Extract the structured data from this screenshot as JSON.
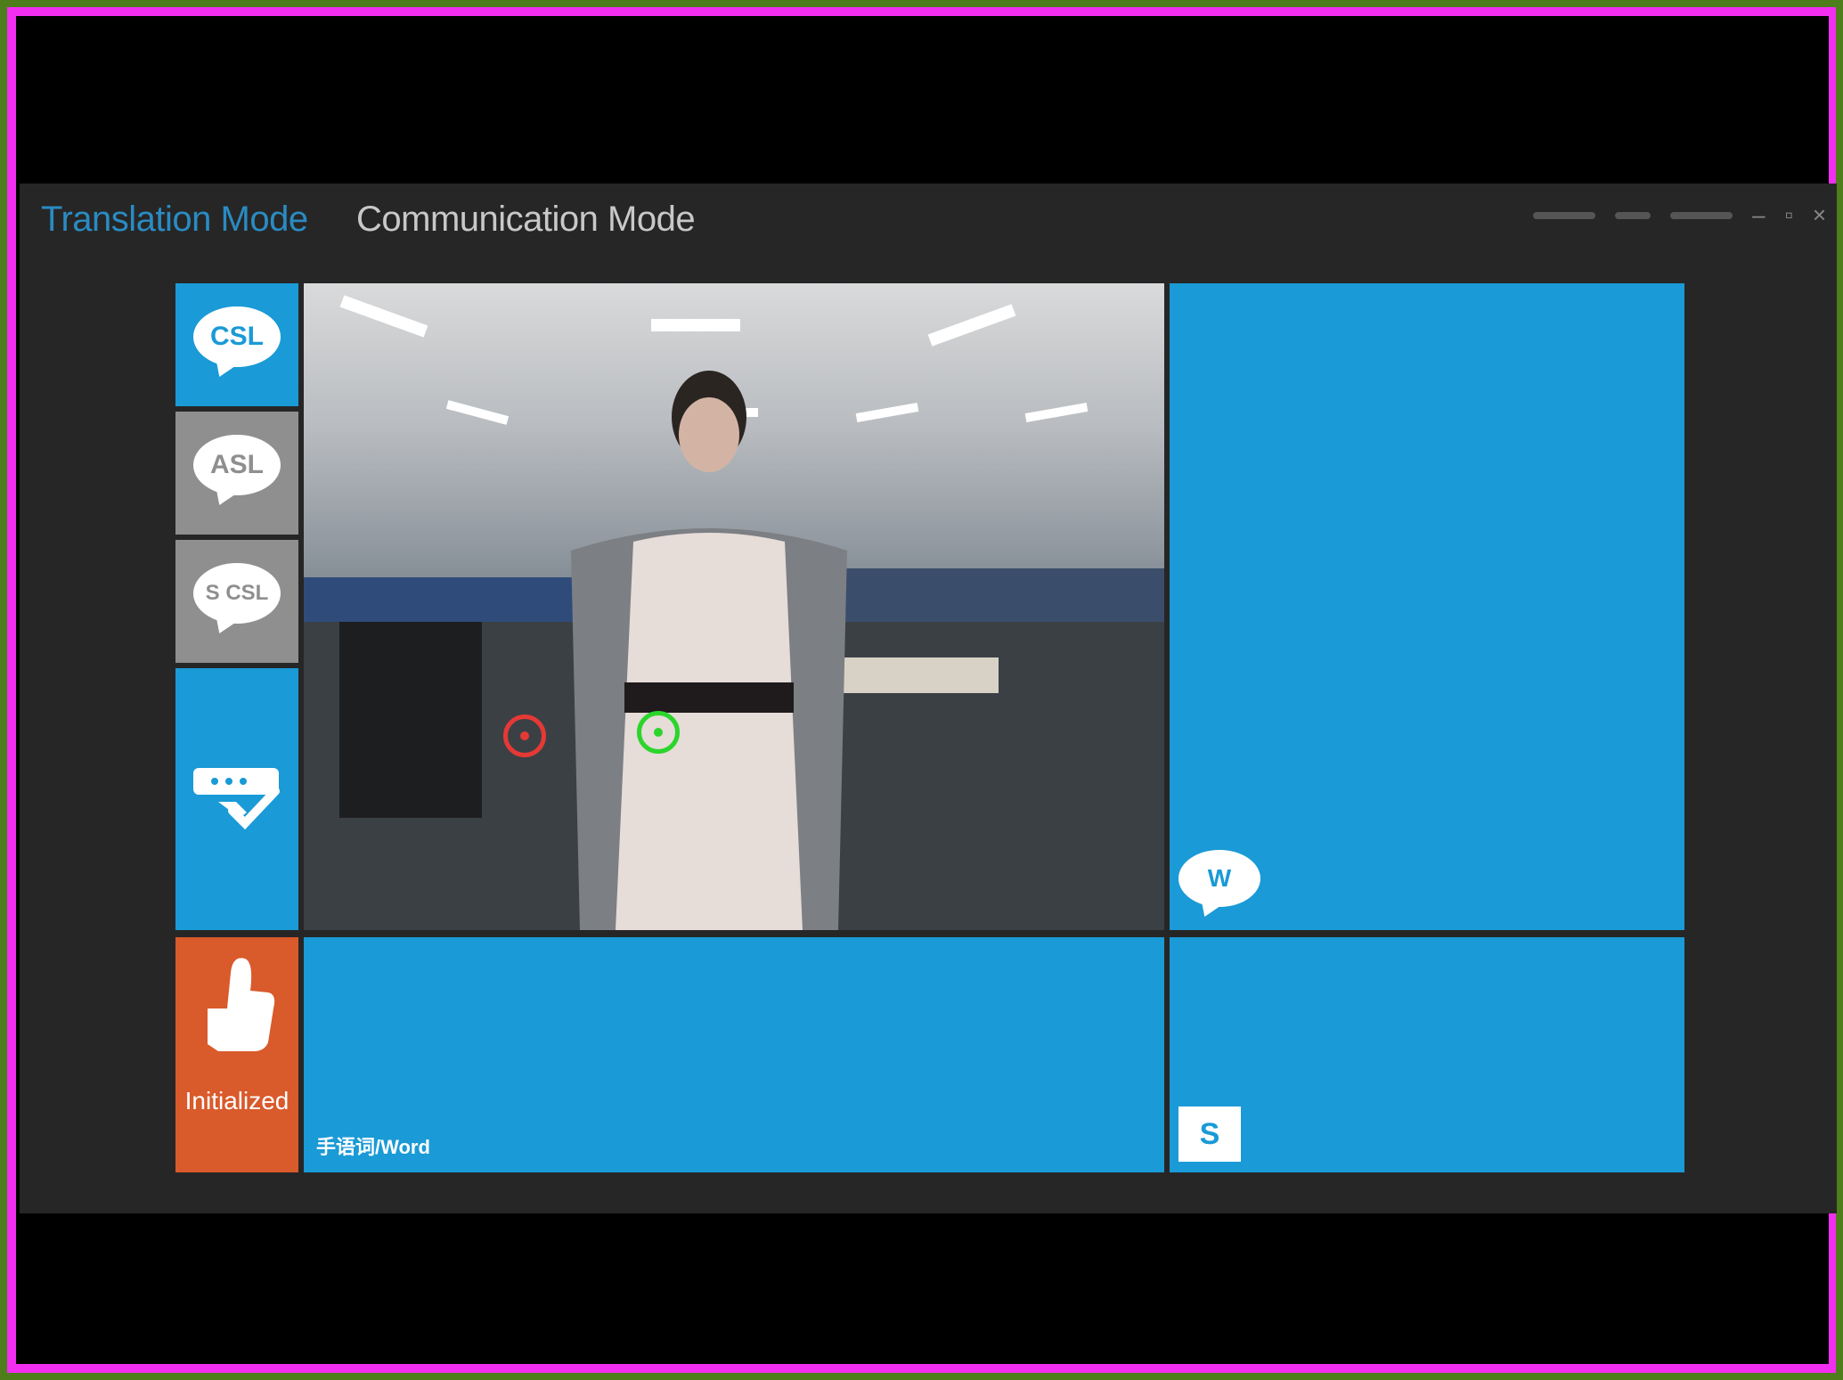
{
  "colors": {
    "accent_blue": "#1a9ad6",
    "tile_gray": "#8f8f8f",
    "init_orange": "#d95a2b",
    "title_active": "#2a8bc2"
  },
  "titlebar": {
    "modes": [
      {
        "label": "Translation Mode",
        "active": true
      },
      {
        "label": "Communication Mode",
        "active": false
      }
    ]
  },
  "sidebar": {
    "items": [
      {
        "label": "CSL",
        "icon": "csl-speech-bubble-icon"
      },
      {
        "label": "ASL",
        "icon": "asl-speech-bubble-icon"
      },
      {
        "label": "S CSL",
        "icon": "sentence-csl-speech-bubble-icon"
      },
      {
        "label": "",
        "icon": "confirm-keyboard-check-icon"
      },
      {
        "label": "Initialized",
        "icon": "thumbs-up-icon"
      }
    ]
  },
  "video": {
    "icon": "camera-feed",
    "markers": [
      {
        "color": "#e53935",
        "name": "left-hand"
      },
      {
        "color": "#2bd52b",
        "name": "right-hand"
      }
    ]
  },
  "panels": {
    "word_label": "手语词/Word",
    "word_icon_text": "W",
    "sentence_icon_text": "S"
  }
}
